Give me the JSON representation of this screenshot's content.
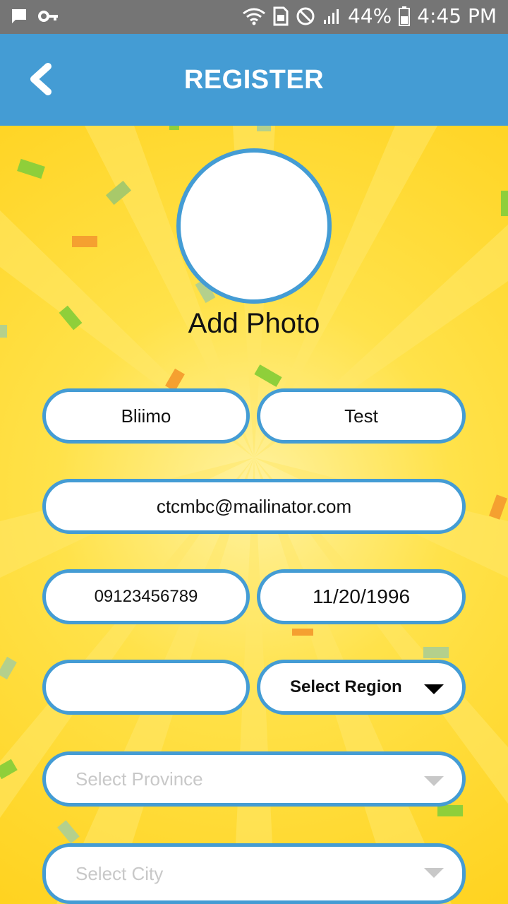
{
  "status_bar": {
    "icons_left": [
      "chat-icon",
      "key-icon"
    ],
    "icons_right": [
      "wifi-icon",
      "sim-icon",
      "do-not-disturb-icon",
      "signal-icon",
      "battery-icon"
    ],
    "battery": "44%",
    "time": "4:45 PM"
  },
  "header": {
    "title": "REGISTER",
    "background": "#449cd4"
  },
  "photo": {
    "label": "Add Photo"
  },
  "form": {
    "first_name": "Bliimo",
    "last_name": "Test",
    "email": "ctcmbc@mailinator.com",
    "phone": "09123456789",
    "birthdate": "11/20/1996",
    "blank_field": "",
    "region": "Select Region",
    "province_placeholder": "Select Province",
    "city_placeholder": "Select City"
  },
  "colors": {
    "accent": "#449cd4",
    "background_yellow": "#ffd21e",
    "placeholder": "#c8c8c8"
  }
}
